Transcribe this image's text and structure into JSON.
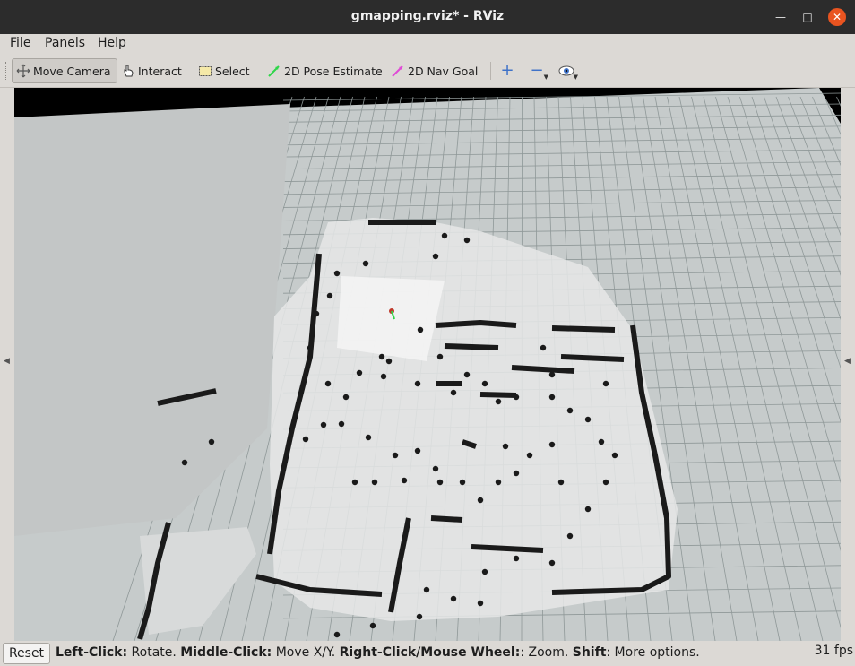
{
  "window": {
    "title": "gmapping.rviz* - RViz",
    "minimize_glyph": "—",
    "maximize_glyph": "□",
    "close_glyph": "✕"
  },
  "menu": {
    "items": [
      "File",
      "Panels",
      "Help"
    ]
  },
  "toolbar": {
    "move_camera": "Move Camera",
    "interact": "Interact",
    "select": "Select",
    "pose_estimate": "2D Pose Estimate",
    "nav_goal": "2D Nav Goal",
    "add_icon": "+",
    "remove_icon": "−",
    "view_icon": "👁",
    "colors": {
      "pose_arrow": "#2fd64a",
      "goal_arrow": "#e04ad6",
      "tool_blue": "#3f72c8"
    }
  },
  "status": {
    "reset_label": "Reset",
    "left_click_key": "Left-Click:",
    "left_click_action": " Rotate. ",
    "middle_click_key": "Middle-Click:",
    "middle_click_action": " Move X/Y. ",
    "right_click_key": "Right-Click/Mouse Wheel:",
    "right_click_action": ": Zoom. ",
    "shift_key": "Shift",
    "shift_action": ": More options.",
    "fps": "31 fps"
  },
  "viewport": {
    "background": "#000000",
    "grid_plane_color": "#c6cbcb",
    "grid_line_color": "#8f9898",
    "map_free_color": "#ececec",
    "map_obstacle_color": "#1a1a1a"
  }
}
